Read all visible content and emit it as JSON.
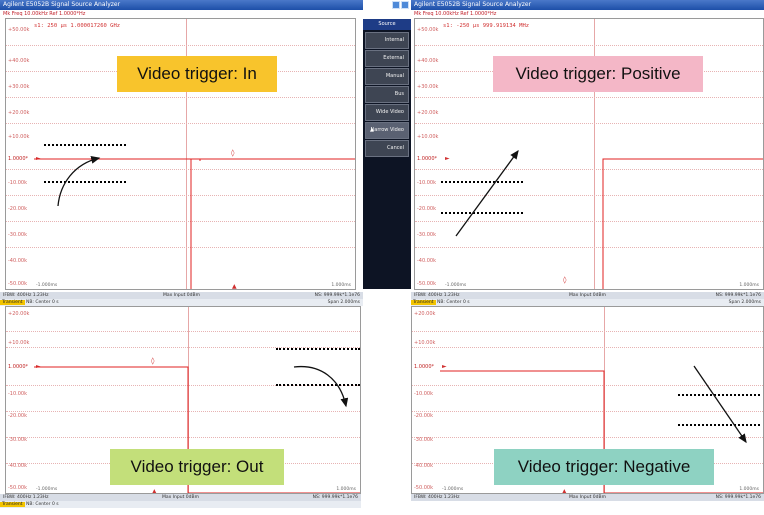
{
  "colors": {
    "trace": "#e02020",
    "callout_in": "#f8c42c",
    "callout_positive": "#f4b7c7",
    "callout_out": "#c3df7a",
    "callout_negative": "#8ed2c2",
    "menu_bg": "#0d1424",
    "titlebar": "#1d4fa8"
  },
  "windows": [
    {
      "title": "Agilent E5052B Signal Source Analyzer",
      "subtitle": "Mk Freq 10.00kHz Ref 1.0000*Hz",
      "marker_readout": "s1: 250 μs 1.000017260 GHz",
      "y_labels": [
        "+50.00k",
        "+40.00k",
        "+30.00k",
        "+20.00k",
        "+10.00k",
        "1.0000*",
        "-10.00k",
        "-20.00k",
        "-30.00k",
        "-40.00k",
        "-50.00k"
      ],
      "x_start": "-1.000ms",
      "x_stop": "1.000ms",
      "status_left": "IFBW: 400Hz 1.23Hz",
      "status_center": "Max Input 0dBm",
      "status_right": "NS: 999.99k*1.1e76",
      "mode_tag": "Transient",
      "mode_text": "NB: Center 0 s",
      "span_text": "Span 2.000ms",
      "trigger": "Video trigger: In"
    },
    {
      "title": "Agilent E5052B Signal Source Analyzer",
      "subtitle": "Mk Freq 10.00kHz Ref 1.0000*Hz",
      "marker_readout": "s1: -250 μs 999.919134 MHz",
      "y_labels": [
        "+50.00k",
        "+40.00k",
        "+30.00k",
        "+20.00k",
        "+10.00k",
        "1.0000*",
        "-10.00k",
        "-20.00k",
        "-30.00k",
        "-40.00k",
        "-50.00k"
      ],
      "x_start": "-1.000ms",
      "x_stop": "1.000ms",
      "status_left": "IFBW: 400Hz 1.23Hz",
      "status_center": "Max Input 0dBm",
      "status_right": "NS: 999.99k*1.1e76",
      "mode_tag": "Transient",
      "mode_text": "NB: Center 0 s",
      "span_text": "Span 2.000ms",
      "trigger": "Video trigger: Positive"
    },
    {
      "y_labels": [
        "+20.00k",
        "+10.00k",
        "1.0000*",
        "-10.00k",
        "-20.00k",
        "-30.00k",
        "-40.00k",
        "-50.00k"
      ],
      "x_start": "-1.000ms",
      "x_stop": "1.000ms",
      "status_left": "IFBW: 400Hz 1.23Hz",
      "status_center": "Max Input 0dBm",
      "status_right": "NS: 999.99k*1.1e76",
      "mode_tag": "Transient",
      "mode_text": "NB: Center 0 s",
      "trigger": "Video trigger: Out"
    },
    {
      "y_labels": [
        "+20.00k",
        "+10.00k",
        "1.0000*",
        "-10.00k",
        "-20.00k",
        "-30.00k",
        "-40.00k",
        "-50.00k"
      ],
      "x_start": "-1.000ms",
      "x_stop": "1.000ms",
      "status_left": "IFBW: 400Hz 1.23Hz",
      "status_center": "Max Input 0dBm",
      "status_right": "NS: 999.99k*1.1e76",
      "trigger": "Video trigger: Negative"
    }
  ],
  "source_menu": {
    "title": "Source",
    "items": [
      "Internal",
      "External",
      "Manual",
      "Bus",
      "Wide Video",
      "Narrow Video",
      "Cancel"
    ],
    "selected": "Narrow Video",
    "selected_mark": "▲"
  },
  "marker_glyph": "►",
  "marker_flag": "▲"
}
